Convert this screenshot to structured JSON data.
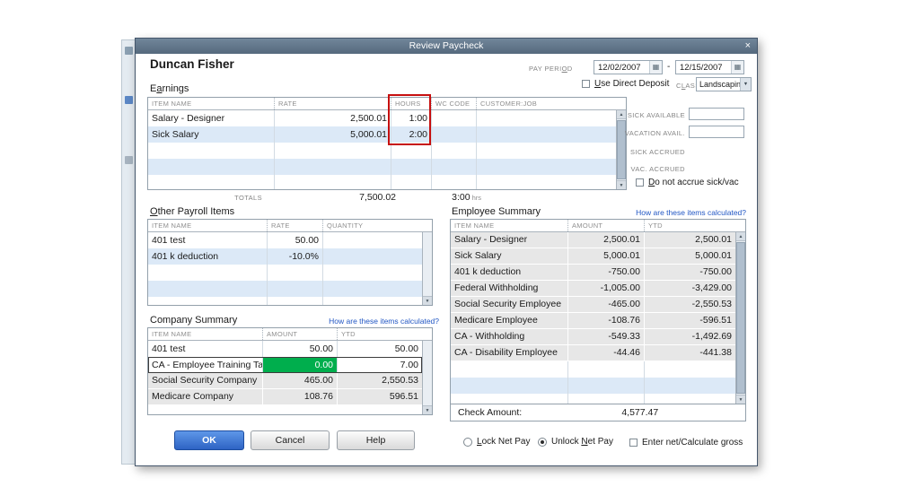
{
  "window": {
    "title": "Review Paycheck"
  },
  "icons": {
    "close": "×",
    "calendar": "▦",
    "dropdown_arrow": "▼",
    "scroll_up": "▲",
    "scroll_down": "▼"
  },
  "header": {
    "employee_name": "Duncan Fisher",
    "pay_period_label": {
      "pre": "PAY PERI",
      "u": "O",
      "post": "D"
    },
    "date_from": "12/02/2007",
    "date_separator": "-",
    "date_to": "12/15/2007",
    "direct_deposit_label": {
      "pre": "",
      "u": "U",
      "post": "se Direct Deposit"
    },
    "class_label": {
      "pre": "C",
      "u": "L",
      "post": "ASS"
    },
    "class_value": "Landscaping"
  },
  "earnings": {
    "title": {
      "pre": "E",
      "u": "a",
      "post": "rnings"
    },
    "columns": {
      "item": "ITEM NAME",
      "rate": "RATE",
      "hours": "HOURS",
      "wc": "WC CODE",
      "customer": "CUSTOMER:JOB"
    },
    "rows": [
      {
        "item": "Salary - Designer",
        "rate": "2,500.01",
        "hours": "1:00"
      },
      {
        "item": "Sick Salary",
        "rate": "5,000.01",
        "hours": "2:00"
      }
    ],
    "totals_label": "TOTALS",
    "rate_total": "7,500.02",
    "hours_total": "3:00",
    "hours_unit": "hrs"
  },
  "sick_vac": {
    "sick_available_label": "SICK AVAILABLE",
    "sick_available_value": "",
    "vacation_avail_label": "VACATION AVAIL.",
    "vacation_avail_value": "",
    "sick_accrued_label": "SICK ACCRUED",
    "vac_accrued_label": "VAC. ACCRUED",
    "do_not_accrue_label": {
      "pre": "",
      "u": "D",
      "post": "o not accrue sick/vac"
    }
  },
  "other_payroll": {
    "title": {
      "pre": "",
      "u": "O",
      "post": "ther Payroll Items"
    },
    "columns": {
      "item": "ITEM NAME",
      "rate": "RATE",
      "quantity": "QUANTITY"
    },
    "rows": [
      {
        "item": "401 test",
        "rate": "50.00",
        "quantity": ""
      },
      {
        "item": "401 k deduction",
        "rate": "-10.0%",
        "quantity": ""
      }
    ]
  },
  "company_summary": {
    "title": "Company Summary",
    "link": "How are these items calculated?",
    "columns": {
      "item": "ITEM NAME",
      "amount": "AMOUNT",
      "ytd": "YTD"
    },
    "rows": [
      {
        "item": "401 test",
        "amount": "50.00",
        "ytd": "50.00"
      },
      {
        "item": "CA - Employee Training Tax",
        "amount": "0.00",
        "ytd": "7.00"
      },
      {
        "item": "Social Security Company",
        "amount": "465.00",
        "ytd": "2,550.53"
      },
      {
        "item": "Medicare Company",
        "amount": "108.76",
        "ytd": "596.51"
      }
    ]
  },
  "employee_summary": {
    "title": "Employee Summary",
    "link": "How are these items calculated?",
    "columns": {
      "item": "ITEM NAME",
      "amount": "AMOUNT",
      "ytd": "YTD"
    },
    "rows": [
      {
        "item": "Salary - Designer",
        "amount": "2,500.01",
        "ytd": "2,500.01"
      },
      {
        "item": "Sick Salary",
        "amount": "5,000.01",
        "ytd": "5,000.01"
      },
      {
        "item": "401 k deduction",
        "amount": "-750.00",
        "ytd": "-750.00"
      },
      {
        "item": "Federal Withholding",
        "amount": "-1,005.00",
        "ytd": "-3,429.00"
      },
      {
        "item": "Social Security Employee",
        "amount": "-465.00",
        "ytd": "-2,550.53"
      },
      {
        "item": "Medicare Employee",
        "amount": "-108.76",
        "ytd": "-596.51"
      },
      {
        "item": "CA - Withholding",
        "amount": "-549.33",
        "ytd": "-1,492.69"
      },
      {
        "item": "CA - Disability Employee",
        "amount": "-44.46",
        "ytd": "-441.38"
      }
    ],
    "check_amount_label": "Check Amount:",
    "check_amount_value": "4,577.47"
  },
  "buttons": {
    "ok": "OK",
    "cancel": "Cancel",
    "help": "Help"
  },
  "footer": {
    "lock_net_pay": {
      "pre": "",
      "u": "L",
      "post": "ock Net Pay"
    },
    "unlock_net_pay": {
      "pre": "Unlock ",
      "u": "N",
      "post": "et Pay"
    },
    "enter_net_label": "Enter net/Calculate gross"
  },
  "colors": {
    "titlebar": "#5e7386",
    "selected_cell_green": "#00ae4d",
    "highlight_box_red": "#c60f0f",
    "row_alt_blue": "#dce9f7",
    "row_filled_gray": "#e7e7e7",
    "link_blue": "#2257c4",
    "ok_button_blue": "#2e63c4"
  }
}
